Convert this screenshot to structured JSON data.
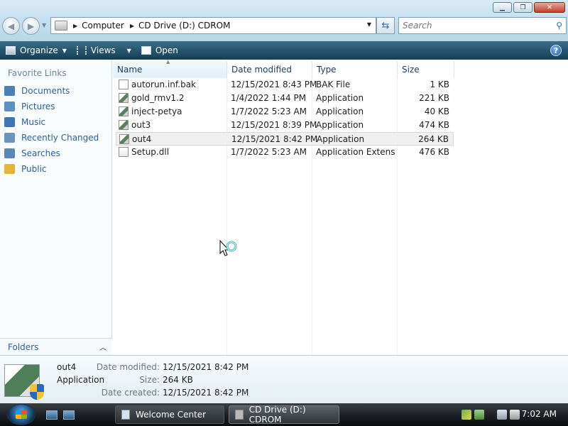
{
  "window": {
    "minimize_glyph": "▁",
    "maximize_glyph": "❐",
    "close_glyph": "✕"
  },
  "address_bar": {
    "breadcrumbs": [
      "Computer",
      "CD Drive (D:) CDROM"
    ],
    "search_placeholder": "Search"
  },
  "command_bar": {
    "organize_label": "Organize",
    "views_label": "Views",
    "open_label": "Open",
    "help_glyph": "?"
  },
  "nav_pane": {
    "header": "Favorite Links",
    "links": [
      {
        "label": "Documents",
        "icon": "documents-icon",
        "color": "#4a7fb5"
      },
      {
        "label": "Pictures",
        "icon": "pictures-icon",
        "color": "#5c8fc2"
      },
      {
        "label": "Music",
        "icon": "music-icon",
        "color": "#3c76b7"
      },
      {
        "label": "Recently Changed",
        "icon": "recently-changed-icon",
        "color": "#6c95bd"
      },
      {
        "label": "Searches",
        "icon": "searches-icon",
        "color": "#5a86b8"
      },
      {
        "label": "Public",
        "icon": "public-folder-icon",
        "color": "#e5b53a"
      }
    ],
    "folders_label": "Folders"
  },
  "file_list": {
    "columns": [
      "Name",
      "Date modified",
      "Type",
      "Size"
    ],
    "rows": [
      {
        "name": "autorun.inf.bak",
        "date": "12/15/2021 8:43 PM",
        "type": "BAK File",
        "size": "1 KB",
        "icon": "file-icon"
      },
      {
        "name": "gold_rmv1.2",
        "date": "1/4/2022 1:44 PM",
        "type": "Application",
        "size": "221 KB",
        "icon": "application-icon"
      },
      {
        "name": "inject-petya",
        "date": "1/7/2022 5:23 AM",
        "type": "Application",
        "size": "40 KB",
        "icon": "application-icon"
      },
      {
        "name": "out3",
        "date": "12/15/2021 8:39 PM",
        "type": "Application",
        "size": "474 KB",
        "icon": "application-icon"
      },
      {
        "name": "out4",
        "date": "12/15/2021 8:42 PM",
        "type": "Application",
        "size": "264 KB",
        "icon": "application-icon",
        "selected": true
      },
      {
        "name": "Setup.dll",
        "date": "1/7/2022 5:23 AM",
        "type": "Application Extens...",
        "size": "476 KB",
        "icon": "dll-icon"
      }
    ]
  },
  "details": {
    "name": "out4",
    "type": "Application",
    "date_modified_label": "Date modified:",
    "date_modified": "12/15/2021 8:42 PM",
    "size_label": "Size:",
    "size": "264 KB",
    "date_created_label": "Date created:",
    "date_created": "12/15/2021 8:42 PM"
  },
  "taskbar": {
    "tasks": [
      "Welcome Center",
      "CD Drive (D:) CDROM"
    ],
    "clock": "7:02 AM"
  }
}
